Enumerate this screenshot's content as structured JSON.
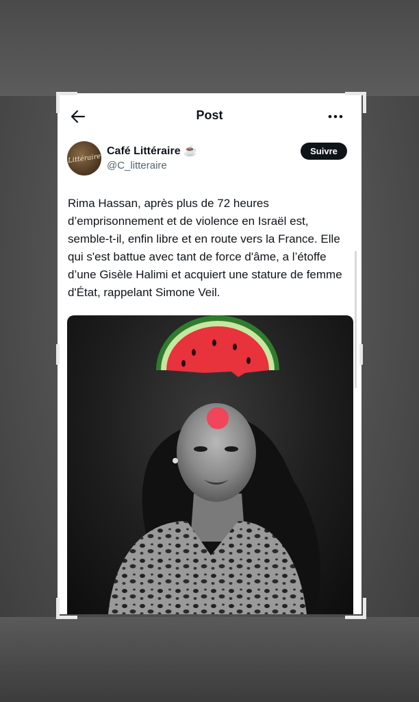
{
  "header": {
    "title": "Post"
  },
  "author": {
    "name": "Café Littéraire ☕",
    "handle": "@C_litteraire",
    "avatar_text": "Littéraire"
  },
  "follow_label": "Suivre",
  "tweet": {
    "text": "Rima Hassan, après plus de 72 heures d’emprisonnement et de violence en Israël est, semble-t-il, enfin libre et en route vers la France. Elle qui s'est battue avec tant de force d'âme, a l’étoffe d’une Gisèle Halimi et acquiert une stature de femme d'État, rappelant Simone Veil."
  },
  "icons": {
    "back": "arrow-left-icon",
    "more": "more-dots-icon"
  },
  "colors": {
    "text": "#0f1419",
    "secondary": "#536471",
    "follow_bg": "#0f1419",
    "watermelon_flesh": "#e8323c",
    "watermelon_rind": "#2e7d2e",
    "clown_nose": "#f0455a"
  }
}
